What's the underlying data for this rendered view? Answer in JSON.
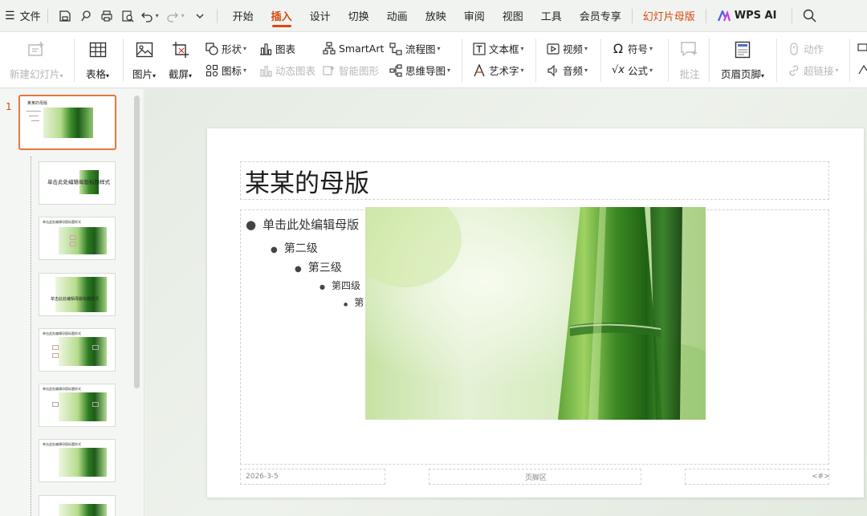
{
  "menubar": {
    "file_label": "文件",
    "tabs": [
      {
        "label": "开始"
      },
      {
        "label": "插入"
      },
      {
        "label": "设计"
      },
      {
        "label": "切换"
      },
      {
        "label": "动画"
      },
      {
        "label": "放映"
      },
      {
        "label": "审阅"
      },
      {
        "label": "视图"
      },
      {
        "label": "工具"
      },
      {
        "label": "会员专享"
      },
      {
        "label": "幻灯片母版"
      },
      {
        "label": "WPS AI"
      }
    ]
  },
  "ribbon": {
    "new_slide": "新建幻灯片",
    "table": "表格",
    "picture": "图片",
    "screenshot": "截屏",
    "shape": "形状",
    "icon": "图标",
    "chart": "图表",
    "dynamic_chart": "动态图表",
    "smartart": "SmartArt",
    "smart_shape": "智能图形",
    "flowchart": "流程图",
    "mindmap": "思维导图",
    "textbox": "文本框",
    "wordart": "艺术字",
    "video": "视频",
    "audio": "音频",
    "symbol": "符号",
    "formula": "公式",
    "comment": "批注",
    "header_footer": "页眉页脚",
    "action": "动作",
    "hyperlink": "超链接"
  },
  "slides_panel": {
    "slide_number": "1",
    "thumb_titles": [
      "某某的母版",
      "单击此处编辑母版标题样式",
      "单击此处编辑母版标题样式",
      "单击此处编辑母版标题样式",
      "单击此处编辑母版标题样式",
      "单击此处编辑母版标题样式",
      "单击此处编辑母版标题样式"
    ]
  },
  "slide": {
    "title": "某某的母版",
    "bullets": [
      {
        "level": 1,
        "text": "单击此处编辑母版"
      },
      {
        "level": 2,
        "text": "第二级"
      },
      {
        "level": 3,
        "text": "第三级"
      },
      {
        "level": 4,
        "text": "第四级"
      },
      {
        "level": 5,
        "text": "第"
      }
    ],
    "footer_date": "2026-3-5",
    "footer_center": "页脚区",
    "footer_page": "<#>"
  },
  "colors": {
    "accent": "#d9480f",
    "selected_border": "#e8763a"
  }
}
